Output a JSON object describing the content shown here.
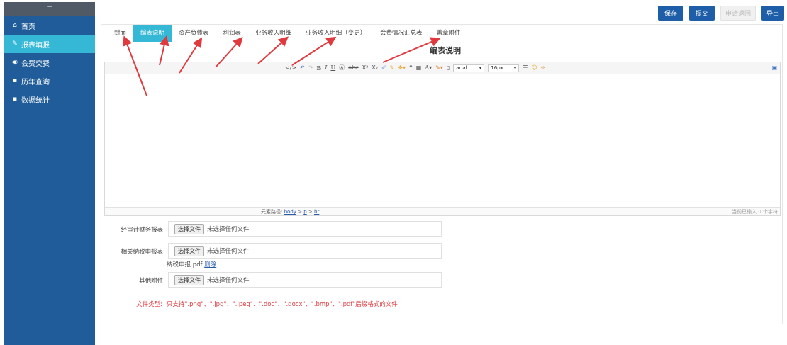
{
  "sidebar": {
    "top_icon": "grid-icon",
    "items": [
      {
        "label": "首页",
        "icon": "home-icon",
        "active": false
      },
      {
        "label": "报表填报",
        "icon": "edit-icon",
        "active": true
      },
      {
        "label": "会费交费",
        "icon": "coin-icon",
        "active": false
      },
      {
        "label": "历年查询",
        "icon": "history-icon",
        "active": false
      },
      {
        "label": "数据统计",
        "icon": "chart-icon",
        "active": false
      }
    ]
  },
  "header": {
    "buttons": {
      "save": "保存",
      "submit": "提交",
      "request_return": "申请退回",
      "export": "导出"
    }
  },
  "tabs": [
    "封面",
    "编表说明",
    "资产负债表",
    "利润表",
    "业务收入明细",
    "业务收入明细（变更）",
    "会费情况汇总表",
    "盖章附件"
  ],
  "active_tab": 1,
  "doc_title": "编表说明",
  "editor": {
    "font_family": "arial",
    "font_size": "16px",
    "path_label": "元素路径:",
    "path": [
      "body",
      "p",
      "br"
    ],
    "char_count": "当前已输入 0 个字符"
  },
  "uploads": [
    {
      "label": "经审计财务报表:",
      "button": "选择文件",
      "status": "未选择任何文件"
    },
    {
      "label": "相关纳税申报表:",
      "button": "选择文件",
      "status": "未选择任何文件"
    },
    {
      "label": "其他附件:",
      "button": "选择文件",
      "status": "未选择任何文件"
    }
  ],
  "attached_file": {
    "name": "纳税申报.pdf",
    "delete": "删除"
  },
  "file_types": {
    "label": "文件类型:",
    "text": "只支持\".png\"、\".jpg\"、\".jpeg\"、\".doc\"、\".docx\"、\".bmp\"、\".pdf\"后缀格式的文件"
  },
  "colors": {
    "sidebar": "#1f5c99",
    "accent": "#35b7d6",
    "primary_button": "#1e5ea8",
    "annotation_arrow": "#e0393e"
  }
}
